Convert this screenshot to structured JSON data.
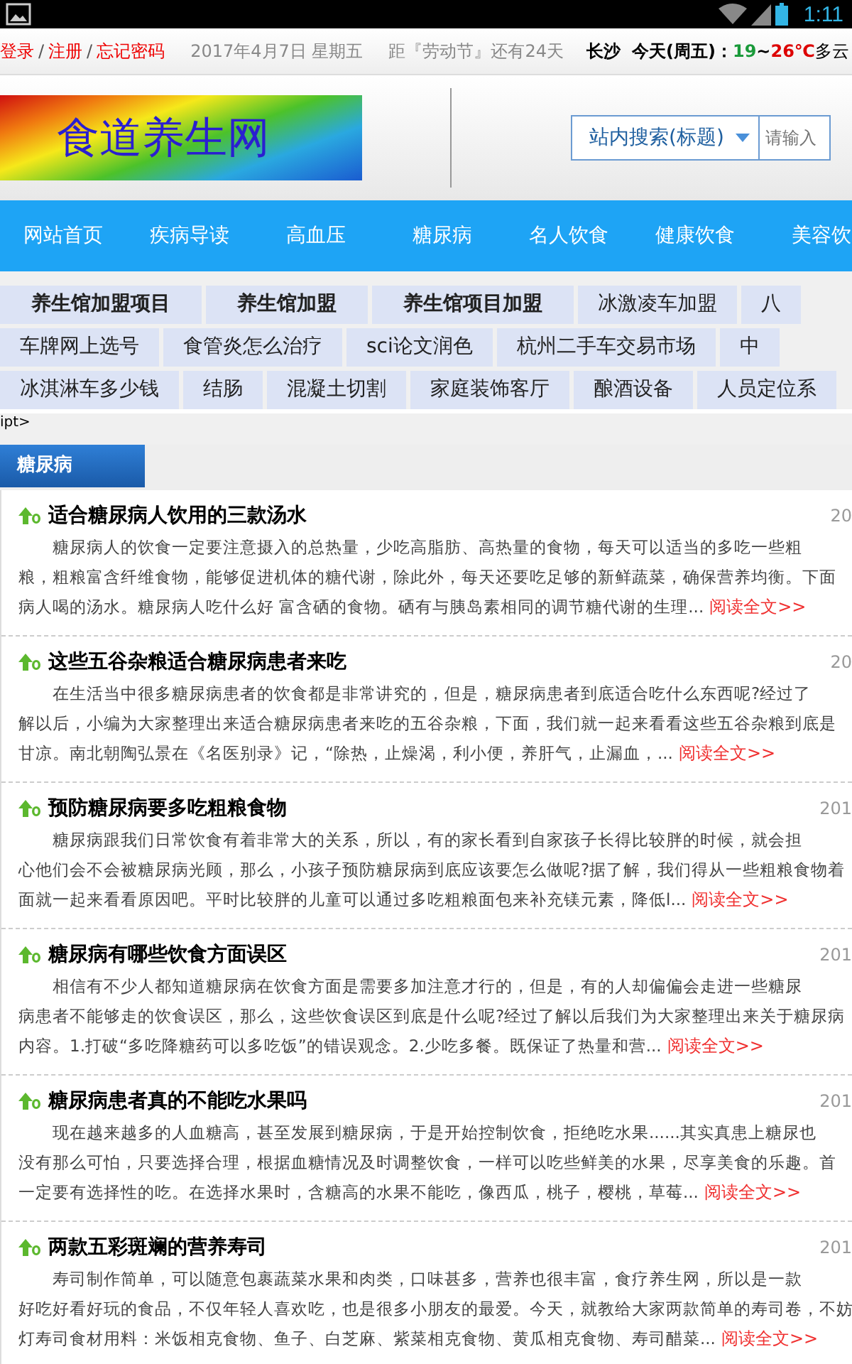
{
  "status_bar": {
    "time": "1:11"
  },
  "top_bar": {
    "links": [
      {
        "label": "登录"
      },
      {
        "label": "注册"
      },
      {
        "label": "忘记密码"
      }
    ],
    "separator": "/",
    "date": "2017年4月7日 星期五",
    "countdown": "距『劳动节』还有24天",
    "city": "长沙",
    "weather": {
      "day": "今天(周五)：",
      "low": "19",
      "tilde": "~",
      "high": "26℃",
      "condition": "多云"
    }
  },
  "header": {
    "logo": "食道养生网",
    "search": {
      "scope": "站内搜索(标题)",
      "placeholder": "请输入"
    }
  },
  "nav": [
    {
      "label": "网站首页"
    },
    {
      "label": "疾病导读"
    },
    {
      "label": "高血压"
    },
    {
      "label": "糖尿病"
    },
    {
      "label": "名人饮食"
    },
    {
      "label": "健康饮食"
    },
    {
      "label": "美容饮"
    }
  ],
  "keyword_rows": [
    [
      {
        "label": "养生馆加盟项目",
        "bold": true
      },
      {
        "label": "养生馆加盟",
        "bold": true
      },
      {
        "label": "养生馆项目加盟",
        "bold": true
      },
      {
        "label": "冰激凌车加盟",
        "bold": false
      },
      {
        "label": "八",
        "bold": false
      }
    ],
    [
      {
        "label": "车牌网上选号",
        "bold": false
      },
      {
        "label": "食管炎怎么治疗",
        "bold": false
      },
      {
        "label": "sci论文润色",
        "bold": false
      },
      {
        "label": "杭州二手车交易市场",
        "bold": false
      },
      {
        "label": "中",
        "bold": false
      }
    ],
    [
      {
        "label": "冰淇淋车多少钱",
        "bold": false
      },
      {
        "label": "结肠",
        "bold": false
      },
      {
        "label": "混凝土切割",
        "bold": false
      },
      {
        "label": "家庭装饰客厅",
        "bold": false
      },
      {
        "label": "酿酒设备",
        "bold": false
      },
      {
        "label": "人员定位系",
        "bold": false
      }
    ]
  ],
  "stray_text": "ipt>",
  "section_tab": "糖尿病",
  "articles": [
    {
      "title": "适合糖尿病人饮用的三款汤水",
      "date": "20",
      "lines": [
        "糖尿病人的饮食一定要注意摄入的总热量，少吃高脂肪、高热量的食物，每天可以适当的多吃一些粗",
        "粮，粗粮富含纤维食物，能够促进机体的糖代谢，除此外，每天还要吃足够的新鲜蔬菜，确保营养均衡。下面",
        "病人喝的汤水。糖尿病人吃什么好 富含硒的食物。硒有与胰岛素相同的调节糖代谢的生理..."
      ],
      "more": "阅读全文>>"
    },
    {
      "title": "这些五谷杂粮适合糖尿病患者来吃",
      "date": "20",
      "lines": [
        "在生活当中很多糖尿病患者的饮食都是非常讲究的，但是，糖尿病患者到底适合吃什么东西呢?经过了",
        "解以后，小编为大家整理出来适合糖尿病患者来吃的五谷杂粮，下面，我们就一起来看看这些五谷杂粮到底是",
        "甘凉。南北朝陶弘景在《名医别录》记，“除热，止燥渴，利小便，养肝气，止漏血，..."
      ],
      "more": "阅读全文>>"
    },
    {
      "title": "预防糖尿病要多吃粗粮食物",
      "date": "201",
      "lines": [
        "糖尿病跟我们日常饮食有着非常大的关系，所以，有的家长看到自家孩子长得比较胖的时候，就会担",
        "心他们会不会被糖尿病光顾，那么，小孩子预防糖尿病到底应该要怎么做呢?据了解，我们得从一些粗粮食物着",
        "面就一起来看看原因吧。平时比较胖的儿童可以通过多吃粗粮面包来补充镁元素，降低l..."
      ],
      "more": "阅读全文>>"
    },
    {
      "title": "糖尿病有哪些饮食方面误区",
      "date": "201",
      "lines": [
        "相信有不少人都知道糖尿病在饮食方面是需要多加注意才行的，但是，有的人却偏偏会走进一些糖尿",
        "病患者不能够走的饮食误区，那么，这些饮食误区到底是什么呢?经过了解以后我们为大家整理出来关于糖尿病",
        "内容。1.打破“多吃降糖药可以多吃饭”的错误观念。2.少吃多餐。既保证了热量和营..."
      ],
      "more": "阅读全文>>"
    },
    {
      "title": "糖尿病患者真的不能吃水果吗",
      "date": "201",
      "lines": [
        "现在越来越多的人血糖高，甚至发展到糖尿病，于是开始控制饮食，拒绝吃水果......其实真患上糖尿也",
        "没有那么可怕，只要选择合理，根据血糖情况及时调整饮食，一样可以吃些鲜美的水果，尽享美食的乐趣。首",
        "一定要有选择性的吃。在选择水果时，含糖高的水果不能吃，像西瓜，桃子，樱桃，草莓..."
      ],
      "more": "阅读全文>>"
    },
    {
      "title": "两款五彩斑斓的营养寿司",
      "date": "201",
      "lines": [
        "寿司制作简单，可以随意包裹蔬菜水果和肉类，口味甚多，营养也很丰富，食疗养生网，所以是一款",
        "好吃好看好玩的食品，不仅年轻人喜欢吃，也是很多小朋友的最爱。今天，就教给大家两款简单的寿司卷，不妨",
        "灯寿司食材用料：米饭相克食物、鱼子、白芝麻、紫菜相克食物、黄瓜相克食物、寿司醋菜..."
      ],
      "more": "阅读全文>>"
    }
  ]
}
